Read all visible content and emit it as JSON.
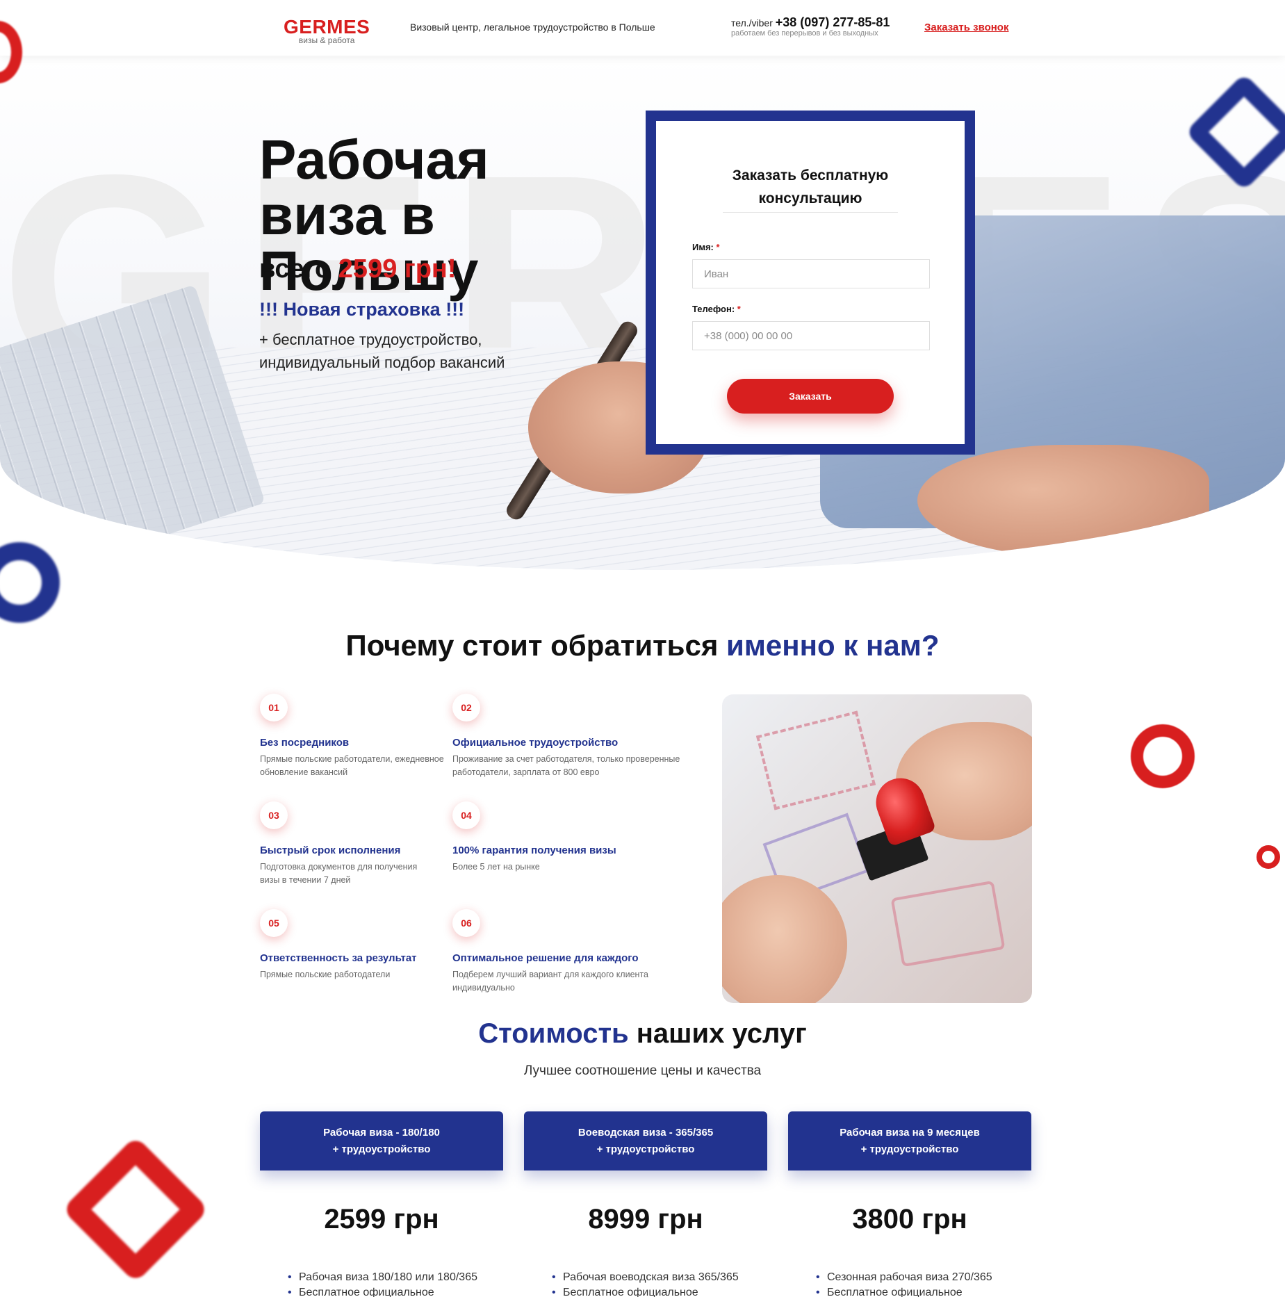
{
  "header": {
    "logo_main": "GERMES",
    "logo_sub": "визы & работа",
    "tagline": "Визовый центр, легальное трудоустройство в Польше",
    "phone_prefix": "тел./viber",
    "phone": "+38 (097) 277-85-81",
    "hours": "работаем без перерывов и без выходных",
    "callback_link": "Заказать звонок"
  },
  "hero": {
    "watermark": "GERMES",
    "title": "Рабочая виза в Польшу",
    "price_prefix": "всего",
    "price": "2599 грн!",
    "insurance": "!!! Новая страховка !!!",
    "description": "+ бесплатное трудоустройство, индивидуальный подбор вакансий"
  },
  "form": {
    "title": "Заказать бесплатную консультацию",
    "name_label": "Имя:",
    "name_placeholder": "Иван",
    "phone_label": "Телефон:",
    "phone_placeholder": "+38 (000) 00 00 00",
    "required_mark": "*",
    "submit": "Заказать"
  },
  "why": {
    "title_start": "Почему стоит обратиться",
    "title_accent": "именно к нам?",
    "features": [
      {
        "num": "01",
        "title": "Без посредников",
        "desc": "Прямые польские работодатели, ежедневное обновление вакансий"
      },
      {
        "num": "02",
        "title": "Официальное трудоустройство",
        "desc": "Проживание за счет работодателя, только проверенные работодатели, зарплата от 800 евро"
      },
      {
        "num": "03",
        "title": "Быстрый срок исполнения",
        "desc": "Подготовка документов для получения визы в течении 7 дней"
      },
      {
        "num": "04",
        "title": "100% гарантия получения визы",
        "desc": "Более 5 лет на рынке"
      },
      {
        "num": "05",
        "title": "Ответственность за результат",
        "desc": "Прямые польские работодатели"
      },
      {
        "num": "06",
        "title": "Оптимальное решение для каждого",
        "desc": "Подберем лучший вариант для каждого клиента индивидуально"
      }
    ]
  },
  "pricing": {
    "title_accent": "Стоимость",
    "title_rest": "наших услуг",
    "subtitle": "Лучшее соотношение цены и качества",
    "cards": [
      {
        "line1": "Рабочая виза - 180/180",
        "line2": "+ трудоустройство",
        "price": "2599 грн",
        "item1": "Рабочая виза 180/180 или 180/365",
        "item2": "Бесплатное официальное"
      },
      {
        "line1": "Воеводская виза - 365/365",
        "line2": "+ трудоустройство",
        "price": "8999 грн",
        "item1": "Рабочая воеводская виза 365/365",
        "item2": "Бесплатное официальное"
      },
      {
        "line1": "Рабочая виза на 9 месяцев",
        "line2": "+ трудоустройство",
        "price": "3800 грн",
        "item1": "Сезонная рабочая виза 270/365",
        "item2": "Бесплатное официальное"
      }
    ]
  },
  "colors": {
    "brand_red": "#d81f1f",
    "brand_blue": "#22338f"
  }
}
